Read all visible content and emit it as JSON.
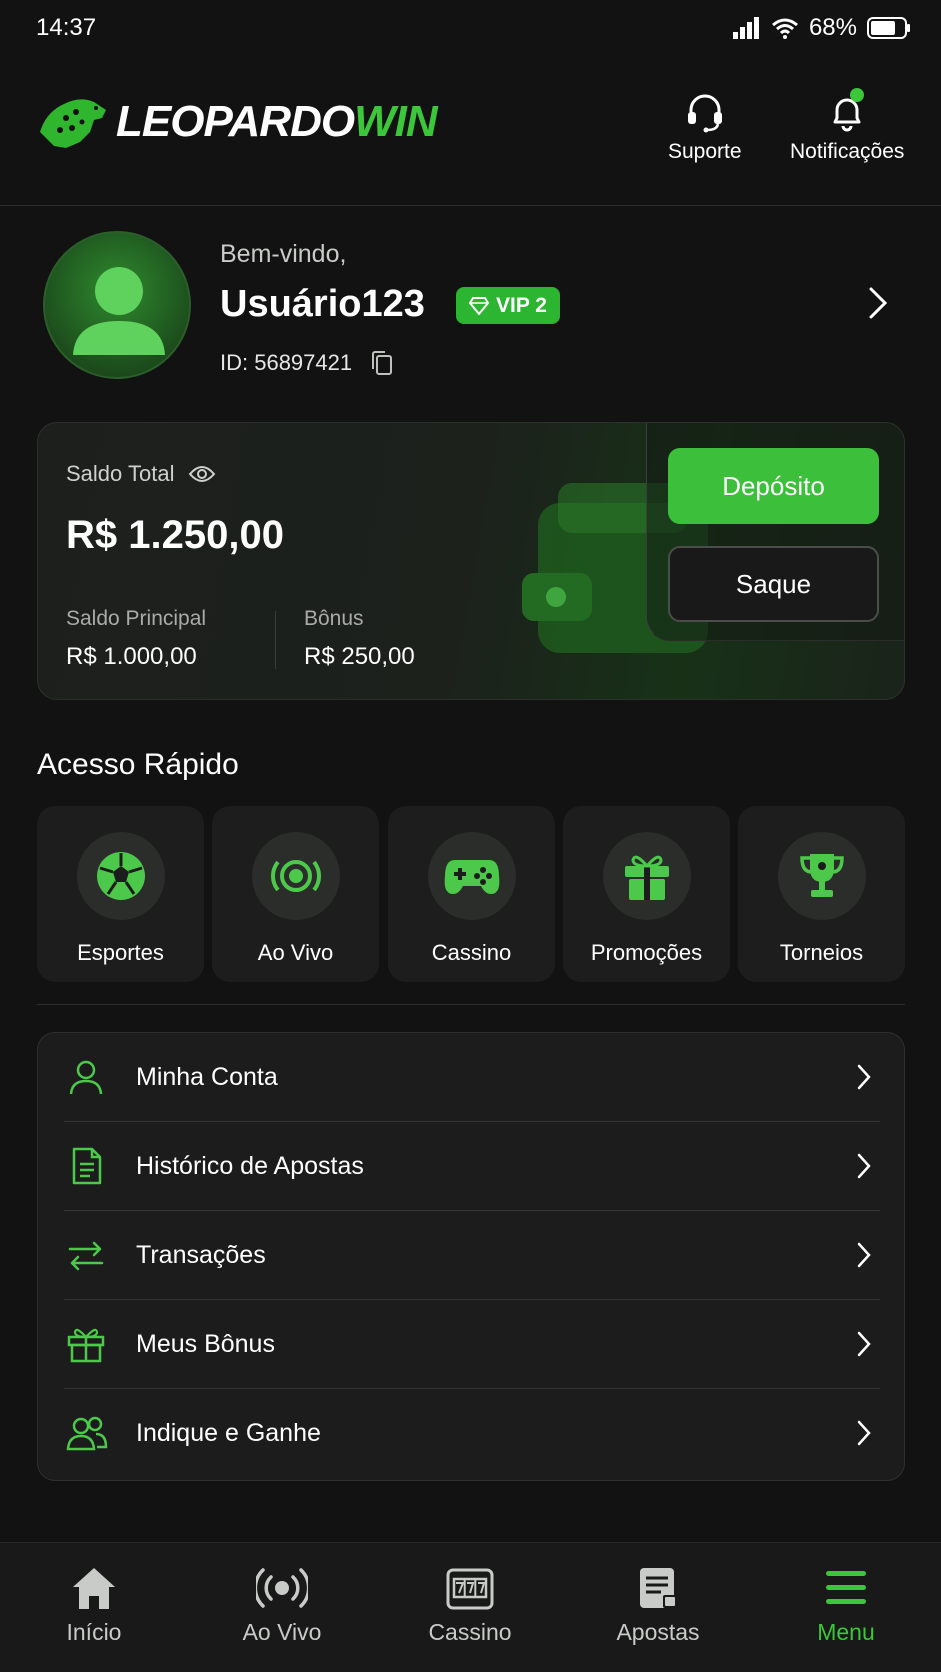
{
  "status_bar": {
    "time": "14:37",
    "battery": "68%"
  },
  "header": {
    "brand_part1": "LEOPARDO",
    "brand_part2": "WIN",
    "support_label": "Suporte",
    "notifications_label": "Notificações"
  },
  "profile": {
    "greeting": "Bem-vindo,",
    "username": "Usuário123",
    "vip_label": "VIP 2",
    "id_text": "ID: 56897421"
  },
  "balance": {
    "total_label": "Saldo Total",
    "total_value": "R$ 1.250,00",
    "main_label": "Saldo Principal",
    "main_value": "R$ 1.000,00",
    "bonus_label": "Bônus",
    "bonus_value": "R$ 250,00",
    "deposit_label": "Depósito",
    "withdraw_label": "Saque"
  },
  "quick_access": {
    "title": "Acesso Rápido",
    "items": [
      {
        "label": "Esportes",
        "icon": "soccer-ball-icon"
      },
      {
        "label": "Ao Vivo",
        "icon": "live-broadcast-icon"
      },
      {
        "label": "Cassino",
        "icon": "gamepad-icon"
      },
      {
        "label": "Promoções",
        "icon": "gift-icon"
      },
      {
        "label": "Torneios",
        "icon": "trophy-icon"
      }
    ]
  },
  "menu": {
    "items": [
      {
        "label": "Minha Conta",
        "icon": "user-icon"
      },
      {
        "label": "Histórico de Apostas",
        "icon": "document-icon"
      },
      {
        "label": "Transações",
        "icon": "arrows-exchange-icon"
      },
      {
        "label": "Meus Bônus",
        "icon": "gift-icon"
      },
      {
        "label": "Indique e Ganhe",
        "icon": "users-icon"
      }
    ]
  },
  "bottom_nav": {
    "items": [
      {
        "label": "Início",
        "icon": "home-icon"
      },
      {
        "label": "Ao Vivo",
        "icon": "live-broadcast-icon"
      },
      {
        "label": "Cassino",
        "icon": "slot-machine-icon"
      },
      {
        "label": "Apostas",
        "icon": "bet-slip-icon"
      },
      {
        "label": "Menu",
        "icon": "hamburger-menu-icon"
      }
    ],
    "active": "Menu"
  },
  "colors": {
    "accent": "#3cc63a",
    "background": "#111211",
    "card": "#1c1d1c"
  }
}
